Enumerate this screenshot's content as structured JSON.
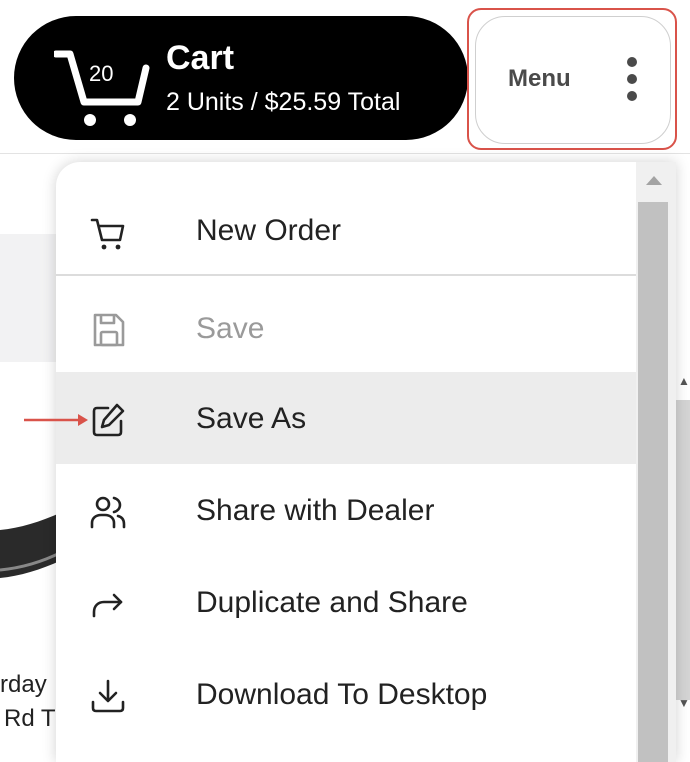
{
  "cart": {
    "count": "20",
    "title": "Cart",
    "summary": "2 Units / $25.59 Total"
  },
  "menu_button": {
    "label": "Menu"
  },
  "dropdown": {
    "items": [
      {
        "label": "New Order",
        "icon": "cart-icon",
        "disabled": false
      },
      {
        "label": "Save",
        "icon": "save-icon",
        "disabled": true
      },
      {
        "label": "Save As",
        "icon": "edit-icon",
        "highlighted": true
      },
      {
        "label": "Share with Dealer",
        "icon": "users-icon"
      },
      {
        "label": "Duplicate and Share",
        "icon": "forward-arrow-icon"
      },
      {
        "label": "Download To Desktop",
        "icon": "download-icon"
      }
    ]
  },
  "background": {
    "text_line1": "rday",
    "text_line2": "Rd T"
  },
  "colors": {
    "cart_background": "#000000",
    "highlight_border": "#d9534a",
    "hover_row": "#ececec",
    "disabled_text": "#9a9a9a"
  }
}
